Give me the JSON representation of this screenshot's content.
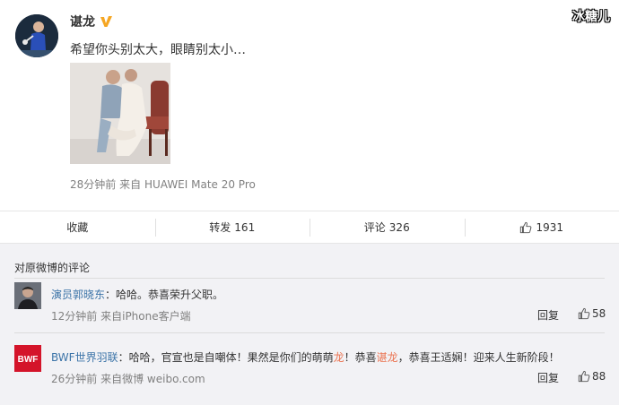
{
  "watermark": "冰糖儿",
  "post": {
    "username": "谌龙",
    "verified_icon": "v-badge-icon",
    "text": "希望你头别太大，眼睛别太小…",
    "time": "28分钟前",
    "source_prefix": "来自",
    "source": "HUAWEI Mate 20 Pro"
  },
  "actions": {
    "favorite_label": "收藏",
    "repost_label": "转发",
    "repost_count": "161",
    "comment_label": "评论",
    "comment_count": "326",
    "like_count": "1931"
  },
  "comments": {
    "title": "对原微博的评论",
    "items": [
      {
        "name": "演员郭晓东",
        "text_before": "：哈哈。恭喜荣升父职。",
        "time": "12分钟前",
        "source": "来自iPhone客户端",
        "reply_label": "回复",
        "likes": "58"
      },
      {
        "name": "BWF世界羽联",
        "text_a": "：哈哈，官宣也是自嘲体！果然是你们的萌萌",
        "hl_a": "龙",
        "text_b": "！恭喜",
        "hl_b": "谌龙",
        "text_c": "，恭喜王适娴！迎来人生新阶段！",
        "time": "26分钟前",
        "source": "来自微博 weibo.com",
        "reply_label": "回复",
        "likes": "88",
        "avatar_text": "BWF"
      }
    ]
  },
  "colors": {
    "link_orange": "#eb7350",
    "link_blue": "#3c74a8",
    "bwf_red": "#d4142a",
    "verified_gold": "#f5a623"
  }
}
